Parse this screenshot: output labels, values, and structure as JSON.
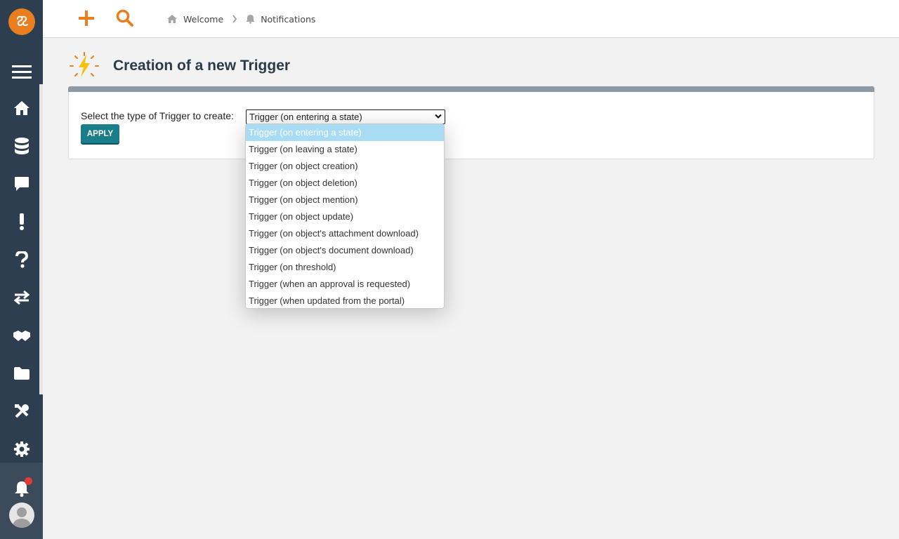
{
  "breadcrumb": [
    {
      "label": "Welcome",
      "icon": "home-icon"
    },
    {
      "label": "Notifications",
      "icon": "bell-icon"
    }
  ],
  "page": {
    "title": "Creation of a new Trigger",
    "icon": "lightning-icon"
  },
  "form": {
    "label": "Select the type of Trigger to create:",
    "selected": "Trigger (on entering a state)",
    "apply_label": "APPLY",
    "options": [
      "Trigger (on entering a state)",
      "Trigger (on leaving a state)",
      "Trigger (on object creation)",
      "Trigger (on object deletion)",
      "Trigger (on object mention)",
      "Trigger (on object update)",
      "Trigger (on object's attachment download)",
      "Trigger (on object's document download)",
      "Trigger (on threshold)",
      "Trigger (when an approval is requested)",
      "Trigger (when updated from the portal)"
    ]
  },
  "sidebar": {
    "items": [
      {
        "icon": "menu-icon"
      },
      {
        "icon": "home-icon"
      },
      {
        "icon": "database-icon"
      },
      {
        "icon": "chat-icon"
      },
      {
        "icon": "exclamation-icon"
      },
      {
        "icon": "question-icon"
      },
      {
        "icon": "transfer-icon"
      },
      {
        "icon": "handshake-icon"
      },
      {
        "icon": "folder-icon"
      },
      {
        "icon": "tools-icon"
      },
      {
        "icon": "settings-icon"
      },
      {
        "icon": "bell-icon"
      }
    ]
  },
  "colors": {
    "accent": "#ea7d1e",
    "sidebar": "#2c3e50",
    "apply_button": "#197d8a",
    "selected_option": "#a8dcf5",
    "notification_dot": "#e53935"
  }
}
